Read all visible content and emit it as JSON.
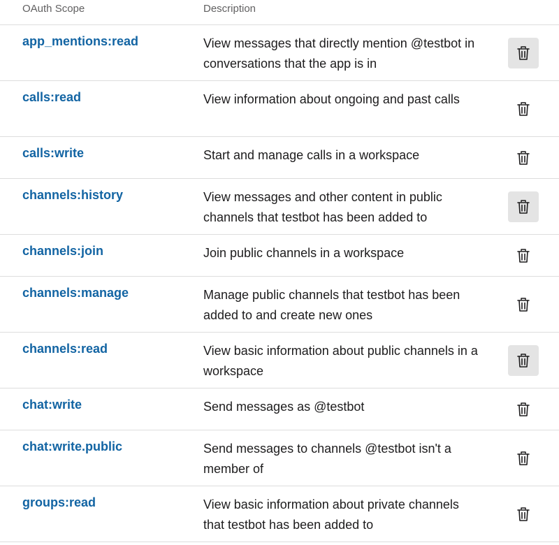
{
  "header": {
    "scope_label": "OAuth Scope",
    "description_label": "Description"
  },
  "scopes": [
    {
      "name": "app_mentions:read",
      "description": "View messages that directly mention @testbot in conversations that the app is in",
      "delete_hover": true
    },
    {
      "name": "calls:read",
      "description": "View information about ongoing and past calls",
      "delete_hover": false
    },
    {
      "name": "calls:write",
      "description": "Start and manage calls in a workspace",
      "delete_hover": false
    },
    {
      "name": "channels:history",
      "description": "View messages and other content in public channels that testbot has been added to",
      "delete_hover": true
    },
    {
      "name": "channels:join",
      "description": "Join public channels in a workspace",
      "delete_hover": false
    },
    {
      "name": "channels:manage",
      "description": "Manage public channels that testbot has been added to and create new ones",
      "delete_hover": false
    },
    {
      "name": "channels:read",
      "description": "View basic information about public channels in a workspace",
      "delete_hover": true
    },
    {
      "name": "chat:write",
      "description": "Send messages as @testbot",
      "delete_hover": false
    },
    {
      "name": "chat:write.public",
      "description": "Send messages to channels @testbot isn't a member of",
      "delete_hover": false
    },
    {
      "name": "groups:read",
      "description": "View basic information about private channels that testbot has been added to",
      "delete_hover": false
    }
  ],
  "icons": {
    "delete": "trash-icon"
  },
  "colors": {
    "scope_link": "#1264a3",
    "delete_hover_bg": "#e4e4e4",
    "divider": "#dddddd"
  }
}
